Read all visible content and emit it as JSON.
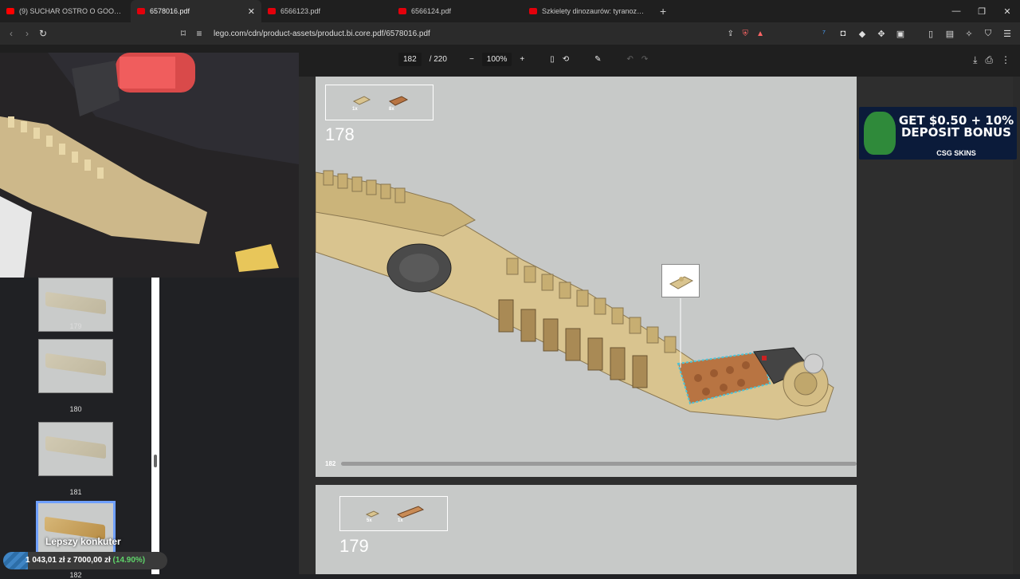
{
  "tabs": [
    {
      "title": "(9) SUCHAR OSTRO O GOODIES! OD...",
      "favicon_color": "#ff0000",
      "active": false
    },
    {
      "title": "6578016.pdf",
      "favicon_color": "#e3000b",
      "active": true
    },
    {
      "title": "6566123.pdf",
      "favicon_color": "#e3000b",
      "active": false
    },
    {
      "title": "6566124.pdf",
      "favicon_color": "#e3000b",
      "active": false
    },
    {
      "title": "Szkielety dinozaurów: tyranozaur 769...",
      "favicon_color": "#e3000b",
      "active": false
    }
  ],
  "newtab_icon": "+",
  "address": {
    "url": "lego.com/cdn/product-assets/product.bi.core.pdf/6578016.pdf"
  },
  "pdf_toolbar": {
    "page_current": "182",
    "page_total": "/ 220",
    "zoom": "100%"
  },
  "thumbnails": [
    {
      "label": "179",
      "selected": false
    },
    {
      "label": "180",
      "selected": false
    },
    {
      "label": "181",
      "selected": false
    },
    {
      "label": "182",
      "selected": true
    }
  ],
  "page1": {
    "step": "178",
    "parts": [
      {
        "qty": "1x"
      },
      {
        "qty": "8x"
      }
    ],
    "page_number": "182"
  },
  "page2": {
    "step": "179",
    "parts": [
      {
        "qty": "5x"
      },
      {
        "qty": "1x"
      }
    ]
  },
  "ad": {
    "headline": "GET $0.50 + 10% DEPOSIT BONUS",
    "brand": "CSG SKINS"
  },
  "overlay": {
    "title": "Lepszy konkuter",
    "goal_current": "1 043,01 zł",
    "goal_sep": "z",
    "goal_target": "7000,00 zł",
    "goal_percent": "(14.90%)",
    "goal_fraction": 0.149
  },
  "colors": {
    "brick_tan": "#d7c28a",
    "page_bg": "#c7c9c8",
    "accent": "#6fa0ff"
  }
}
